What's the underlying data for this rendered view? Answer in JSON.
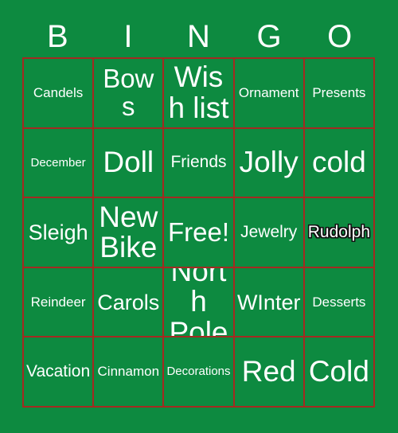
{
  "card": {
    "background_color": "#0d8a40",
    "grid_line_color": "#a32a21",
    "text_color": "#ffffff",
    "marked_outline_color": "#111111"
  },
  "header": {
    "letters": [
      {
        "label": "B"
      },
      {
        "label": "I"
      },
      {
        "label": "N"
      },
      {
        "label": "G"
      },
      {
        "label": "O"
      }
    ]
  },
  "grid": {
    "rows": 5,
    "columns": 5,
    "cells": [
      {
        "label": "Candels",
        "size": "fs-s",
        "marked": false
      },
      {
        "label": "Bows",
        "size": "fs-xl",
        "marked": false
      },
      {
        "label": "Wish list",
        "size": "fs-xxl",
        "marked": false
      },
      {
        "label": "Ornament",
        "size": "fs-s",
        "marked": false
      },
      {
        "label": "Presents",
        "size": "fs-s",
        "marked": false
      },
      {
        "label": "December",
        "size": "fs-xs",
        "marked": false
      },
      {
        "label": "Doll",
        "size": "fs-xxl",
        "marked": false
      },
      {
        "label": "Friends",
        "size": "fs-m",
        "marked": false
      },
      {
        "label": "Jolly",
        "size": "fs-xxl",
        "marked": false
      },
      {
        "label": "cold",
        "size": "fs-xxl",
        "marked": false
      },
      {
        "label": "Sleigh",
        "size": "fs-l",
        "marked": false
      },
      {
        "label": "New Bike",
        "size": "fs-xxl",
        "marked": false
      },
      {
        "label": "Free!",
        "size": "fs-xl",
        "marked": false
      },
      {
        "label": "Jewelry",
        "size": "fs-m",
        "marked": false
      },
      {
        "label": "Rudolph",
        "size": "fs-m",
        "marked": true
      },
      {
        "label": "Reindeer",
        "size": "fs-s",
        "marked": false
      },
      {
        "label": "Carols",
        "size": "fs-l",
        "marked": false
      },
      {
        "label": "North Pole",
        "size": "fs-xxl",
        "marked": false
      },
      {
        "label": "WInter",
        "size": "fs-l",
        "marked": false
      },
      {
        "label": "Desserts",
        "size": "fs-s",
        "marked": false
      },
      {
        "label": "Vacation",
        "size": "fs-m",
        "marked": false
      },
      {
        "label": "Cinnamon",
        "size": "fs-s",
        "marked": false
      },
      {
        "label": "Decorations",
        "size": "fs-xs",
        "marked": false
      },
      {
        "label": "Red",
        "size": "fs-xxl",
        "marked": false
      },
      {
        "label": "Cold",
        "size": "fs-xxl",
        "marked": false
      }
    ]
  }
}
